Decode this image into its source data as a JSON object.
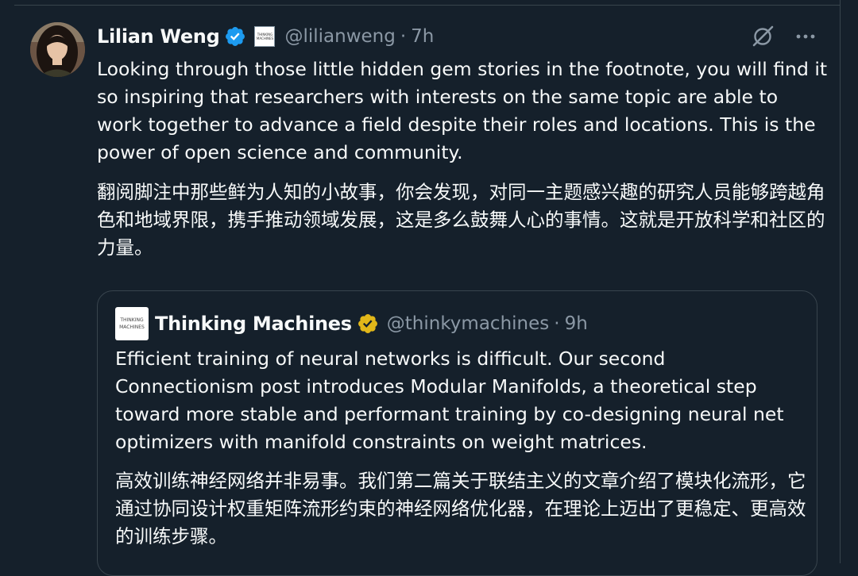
{
  "tweet": {
    "author": {
      "name": "Lilian Weng",
      "handle": "@lilianweng",
      "time": "7h",
      "separator": "·",
      "affiliate_logo_text": [
        "THINKING",
        "MACHINES"
      ]
    },
    "text_en": "Looking through those little hidden gem stories in the footnote, you will find it so inspiring that researchers with interests on the same topic are able to work together to advance a field despite their roles and locations. This is the power of open science and community.",
    "text_cn": "翻阅脚注中那些鲜为人知的小故事，你会发现，对同一主题感兴趣的研究人员能够跨越角色和地域界限，携手推动领域发展，这是多么鼓舞人心的事情。这就是开放科学和社区的力量。"
  },
  "quoted": {
    "author": {
      "name": "Thinking Machines",
      "handle": "@thinkymachines",
      "time": "9h",
      "separator": "·",
      "avatar_text": [
        "THINKING",
        "MACHINES"
      ]
    },
    "text_en": "Efficient training of neural networks is difficult. Our second Connectionism post introduces Modular Manifolds, a theoretical step toward more stable and performant training by co-designing neural net optimizers with manifold constraints on weight matrices.",
    "text_cn": "高效训练神经网络并非易事。我们第二篇关于联结主义的文章介绍了模块化流形，它通过协同设计权重矩阵流形约束的神经网络优化器，在理论上迈出了更稳定、更高效的训练步骤。"
  },
  "icons": {
    "verified_blue": "verified-badge-icon",
    "verified_gold": "gold-verified-badge-icon",
    "grok": "grok-icon",
    "more": "more-icon"
  },
  "colors": {
    "background": "#15202b",
    "text": "#f7f9f9",
    "muted": "#8b98a5",
    "border": "#38444d",
    "verified_blue": "#1d9bf0",
    "verified_gold": "#e2b719"
  }
}
